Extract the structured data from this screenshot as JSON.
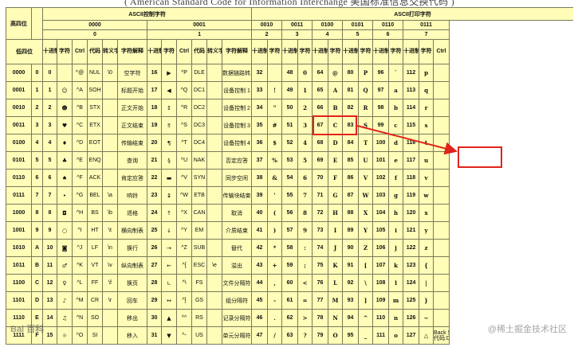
{
  "banner": "( American Standard Code for Information Interchange 美国标准信息交换代码 )",
  "headers": {
    "corner_high": "高四位",
    "corner_low": "低四位",
    "group_control": "ASCII控制字符",
    "group_print": "ASCII打印字符"
  },
  "groups": [
    {
      "bin": "0000",
      "hex": "0"
    },
    {
      "bin": "0001",
      "hex": "1"
    },
    {
      "bin": "0010",
      "hex": "2"
    },
    {
      "bin": "0011",
      "hex": "3"
    },
    {
      "bin": "0100",
      "hex": "4"
    },
    {
      "bin": "0101",
      "hex": "5"
    },
    {
      "bin": "0110",
      "hex": "6"
    },
    {
      "bin": "0111",
      "hex": "7"
    }
  ],
  "col_labels": {
    "dec": "十进制",
    "char": "字符",
    "ctrl": "Ctrl",
    "code": "代码",
    "esc": "转义字符",
    "desc": "字符解释"
  },
  "rows": [
    {
      "bin": "0000",
      "hex": "0",
      "c0": {
        "dec": "0",
        "ch": "",
        "ctrl": "^@",
        "code": "NUL",
        "esc": "\\0",
        "desc": "空字符"
      },
      "c1": {
        "dec": "16",
        "ch": "▶",
        "ctrl": "^P",
        "code": "DLE",
        "esc": "",
        "desc": "数据链路转义"
      },
      "p": [
        [
          "32",
          ""
        ],
        [
          "48",
          "0"
        ],
        [
          "64",
          "@"
        ],
        [
          "80",
          "P"
        ],
        [
          "96",
          "`"
        ],
        [
          "112",
          "p"
        ]
      ]
    },
    {
      "bin": "0001",
      "hex": "1",
      "c0": {
        "dec": "1",
        "ch": "☺",
        "ctrl": "^A",
        "code": "SOH",
        "esc": "",
        "desc": "标题开始"
      },
      "c1": {
        "dec": "17",
        "ch": "◀",
        "ctrl": "^Q",
        "code": "DC1",
        "esc": "",
        "desc": "设备控制 1"
      },
      "p": [
        [
          "33",
          "!"
        ],
        [
          "49",
          "1"
        ],
        [
          "65",
          "A"
        ],
        [
          "81",
          "Q"
        ],
        [
          "97",
          "a"
        ],
        [
          "113",
          "q"
        ]
      ]
    },
    {
      "bin": "0010",
      "hex": "2",
      "c0": {
        "dec": "2",
        "ch": "☻",
        "ctrl": "^B",
        "code": "STX",
        "esc": "",
        "desc": "正文开始"
      },
      "c1": {
        "dec": "18",
        "ch": "↕",
        "ctrl": "^R",
        "code": "DC2",
        "esc": "",
        "desc": "设备控制 2"
      },
      "p": [
        [
          "34",
          "\""
        ],
        [
          "50",
          "2"
        ],
        [
          "66",
          "B"
        ],
        [
          "82",
          "R"
        ],
        [
          "98",
          "b"
        ],
        [
          "114",
          "r"
        ]
      ]
    },
    {
      "bin": "0011",
      "hex": "3",
      "c0": {
        "dec": "3",
        "ch": "♥",
        "ctrl": "^C",
        "code": "ETX",
        "esc": "",
        "desc": "正文结束"
      },
      "c1": {
        "dec": "19",
        "ch": "‼",
        "ctrl": "^S",
        "code": "DC3",
        "esc": "",
        "desc": "设备控制 3"
      },
      "p": [
        [
          "35",
          "#"
        ],
        [
          "51",
          "3"
        ],
        [
          "67",
          "C"
        ],
        [
          "83",
          "S"
        ],
        [
          "99",
          "c"
        ],
        [
          "115",
          "s"
        ]
      ]
    },
    {
      "bin": "0100",
      "hex": "4",
      "c0": {
        "dec": "4",
        "ch": "♦",
        "ctrl": "^D",
        "code": "EOT",
        "esc": "",
        "desc": "传输结束"
      },
      "c1": {
        "dec": "20",
        "ch": "¶",
        "ctrl": "^T",
        "code": "DC4",
        "esc": "",
        "desc": "设备控制 4"
      },
      "p": [
        [
          "36",
          "$"
        ],
        [
          "52",
          "4"
        ],
        [
          "68",
          "D"
        ],
        [
          "84",
          "T"
        ],
        [
          "100",
          "d"
        ],
        [
          "116",
          "t"
        ]
      ]
    },
    {
      "bin": "0101",
      "hex": "5",
      "c0": {
        "dec": "5",
        "ch": "♣",
        "ctrl": "^E",
        "code": "ENQ",
        "esc": "",
        "desc": "查询"
      },
      "c1": {
        "dec": "21",
        "ch": "§",
        "ctrl": "^U",
        "code": "NAK",
        "esc": "",
        "desc": "否定应答"
      },
      "p": [
        [
          "37",
          "%"
        ],
        [
          "53",
          "5"
        ],
        [
          "69",
          "E"
        ],
        [
          "85",
          "U"
        ],
        [
          "101",
          "e"
        ],
        [
          "117",
          "u"
        ]
      ]
    },
    {
      "bin": "0110",
      "hex": "6",
      "c0": {
        "dec": "6",
        "ch": "♠",
        "ctrl": "^F",
        "code": "ACK",
        "esc": "",
        "desc": "肯定应答"
      },
      "c1": {
        "dec": "22",
        "ch": "▬",
        "ctrl": "^V",
        "code": "SYN",
        "esc": "",
        "desc": "同步空闲"
      },
      "p": [
        [
          "38",
          "&"
        ],
        [
          "54",
          "6"
        ],
        [
          "70",
          "F"
        ],
        [
          "86",
          "V"
        ],
        [
          "102",
          "f"
        ],
        [
          "118",
          "v"
        ]
      ]
    },
    {
      "bin": "0111",
      "hex": "7",
      "c0": {
        "dec": "7",
        "ch": "•",
        "ctrl": "^G",
        "code": "BEL",
        "esc": "\\a",
        "desc": "响铃"
      },
      "c1": {
        "dec": "23",
        "ch": "↨",
        "ctrl": "^W",
        "code": "ETB",
        "esc": "",
        "desc": "传输块结束"
      },
      "p": [
        [
          "39",
          "'"
        ],
        [
          "55",
          "7"
        ],
        [
          "71",
          "G"
        ],
        [
          "87",
          "W"
        ],
        [
          "103",
          "g"
        ],
        [
          "119",
          "w"
        ]
      ]
    },
    {
      "bin": "1000",
      "hex": "8",
      "c0": {
        "dec": "8",
        "ch": "◘",
        "ctrl": "^H",
        "code": "BS",
        "esc": "\\b",
        "desc": "退格"
      },
      "c1": {
        "dec": "24",
        "ch": "↑",
        "ctrl": "^X",
        "code": "CAN",
        "esc": "",
        "desc": "取消"
      },
      "p": [
        [
          "40",
          "("
        ],
        [
          "56",
          "8"
        ],
        [
          "72",
          "H"
        ],
        [
          "88",
          "X"
        ],
        [
          "104",
          "h"
        ],
        [
          "120",
          "x"
        ]
      ]
    },
    {
      "bin": "1001",
      "hex": "9",
      "c0": {
        "dec": "9",
        "ch": "○",
        "ctrl": "^I",
        "code": "HT",
        "esc": "\\t",
        "desc": "横向制表"
      },
      "c1": {
        "dec": "25",
        "ch": "↓",
        "ctrl": "^Y",
        "code": "EM",
        "esc": "",
        "desc": "介质结束"
      },
      "p": [
        [
          "41",
          ")"
        ],
        [
          "57",
          "9"
        ],
        [
          "73",
          "I"
        ],
        [
          "89",
          "Y"
        ],
        [
          "105",
          "i"
        ],
        [
          "121",
          "y"
        ]
      ]
    },
    {
      "bin": "1010",
      "hex": "A",
      "c0": {
        "dec": "10",
        "ch": "◙",
        "ctrl": "^J",
        "code": "LF",
        "esc": "\\n",
        "desc": "换行"
      },
      "c1": {
        "dec": "26",
        "ch": "→",
        "ctrl": "^Z",
        "code": "SUB",
        "esc": "",
        "desc": "替代"
      },
      "p": [
        [
          "42",
          "*"
        ],
        [
          "58",
          ":"
        ],
        [
          "74",
          "J"
        ],
        [
          "90",
          "Z"
        ],
        [
          "106",
          "j"
        ],
        [
          "122",
          "z"
        ]
      ]
    },
    {
      "bin": "1011",
      "hex": "B",
      "c0": {
        "dec": "11",
        "ch": "♂",
        "ctrl": "^K",
        "code": "VT",
        "esc": "\\v",
        "desc": "纵向制表"
      },
      "c1": {
        "dec": "27",
        "ch": "←",
        "ctrl": "^[",
        "code": "ESC",
        "esc": "\\e",
        "desc": "溢出"
      },
      "p": [
        [
          "43",
          "+"
        ],
        [
          "59",
          ";"
        ],
        [
          "75",
          "K"
        ],
        [
          "91",
          "["
        ],
        [
          "107",
          "k"
        ],
        [
          "123",
          "{"
        ]
      ]
    },
    {
      "bin": "1100",
      "hex": "C",
      "c0": {
        "dec": "12",
        "ch": "♀",
        "ctrl": "^L",
        "code": "FF",
        "esc": "\\f",
        "desc": "换页"
      },
      "c1": {
        "dec": "28",
        "ch": "∟",
        "ctrl": "^\\",
        "code": "FS",
        "esc": "",
        "desc": "文件分隔符"
      },
      "p": [
        [
          "44",
          ","
        ],
        [
          "60",
          "<"
        ],
        [
          "76",
          "L"
        ],
        [
          "92",
          "\\"
        ],
        [
          "108",
          "l"
        ],
        [
          "124",
          "|"
        ]
      ]
    },
    {
      "bin": "1101",
      "hex": "D",
      "c0": {
        "dec": "13",
        "ch": "♪",
        "ctrl": "^M",
        "code": "CR",
        "esc": "\\r",
        "desc": "回车"
      },
      "c1": {
        "dec": "29",
        "ch": "↔",
        "ctrl": "^]",
        "code": "GS",
        "esc": "",
        "desc": "组分隔符"
      },
      "p": [
        [
          "45",
          "-"
        ],
        [
          "61",
          "="
        ],
        [
          "77",
          "M"
        ],
        [
          "93",
          "]"
        ],
        [
          "109",
          "m"
        ],
        [
          "125",
          "}"
        ]
      ]
    },
    {
      "bin": "1110",
      "hex": "E",
      "c0": {
        "dec": "14",
        "ch": "♫",
        "ctrl": "^N",
        "code": "SO",
        "esc": "",
        "desc": "移出"
      },
      "c1": {
        "dec": "30",
        "ch": "▲",
        "ctrl": "^^",
        "code": "RS",
        "esc": "",
        "desc": "记录分隔符"
      },
      "p": [
        [
          "46",
          "."
        ],
        [
          "62",
          ">"
        ],
        [
          "78",
          "N"
        ],
        [
          "94",
          "^"
        ],
        [
          "110",
          "n"
        ],
        [
          "126",
          "~"
        ]
      ]
    },
    {
      "bin": "1111",
      "hex": "F",
      "c0": {
        "dec": "15",
        "ch": "☼",
        "ctrl": "^O",
        "code": "SI",
        "esc": "",
        "desc": "移入"
      },
      "c1": {
        "dec": "31",
        "ch": "▼",
        "ctrl": "^-",
        "code": "US",
        "esc": "",
        "desc": "单元分隔符"
      },
      "p": [
        [
          "47",
          "/"
        ],
        [
          "63",
          "?"
        ],
        [
          "79",
          "O"
        ],
        [
          "95",
          "_"
        ],
        [
          "111",
          "o"
        ],
        [
          "127",
          "△"
        ]
      ]
    }
  ],
  "del_note": "代码:DEL",
  "del_note2": "Back Space",
  "highlight": [
    "35",
    "101"
  ],
  "watermark_left": "Bai 百科",
  "watermark_right": "@稀土掘金技术社区",
  "colors": {
    "highlight": "#e0241b",
    "cell": "#fffdb8",
    "row_header": "#8fd6ef",
    "hex_band": "#6fd76a"
  }
}
